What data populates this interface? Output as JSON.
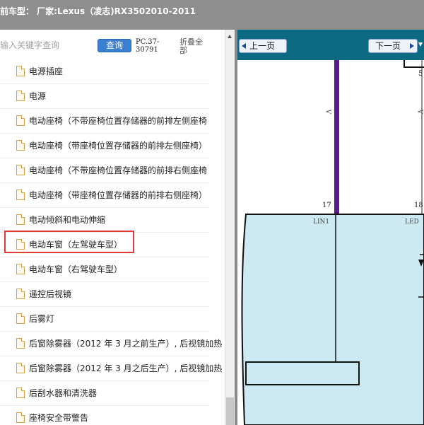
{
  "window": {
    "title": "前车型： 厂家:Lexus（凌志)RX3502010-2011"
  },
  "search": {
    "placeholder": "输入关键字查询",
    "query_label": "查询",
    "pc_code": "PC.37-30791",
    "collapse_label": "折叠全部"
  },
  "tree": {
    "items": [
      {
        "label": "电源插座"
      },
      {
        "label": "电源"
      },
      {
        "label": "电动座椅（不带座椅位置存储器的前排左侧座椅"
      },
      {
        "label": "电动座椅（带座椅位置存储器的前排左侧座椅）"
      },
      {
        "label": "电动座椅（不带座椅位置存储器的前排右侧座椅"
      },
      {
        "label": "电动座椅（带座椅位置存储器的前排右侧座椅）"
      },
      {
        "label": "电动倾斜和电动伸缩"
      },
      {
        "label": "电动车窗（左驾驶车型）",
        "highlighted": true
      },
      {
        "label": "电动车窗（右驾驶车型）"
      },
      {
        "label": "遥控后视镜"
      },
      {
        "label": "后雾灯"
      },
      {
        "label": "后窗除雾器（2012 年 3 月之前生产）, 后视镜加热"
      },
      {
        "label": "后窗除雾器（2012 年 3 月之后生产）, 后视镜加热"
      },
      {
        "label": "后刮水器和清洗器"
      },
      {
        "label": "座椅安全带警告"
      }
    ]
  },
  "viewer": {
    "prev_label": "上一页",
    "next_label": "下一页",
    "pin_left": "17",
    "pin_right": "18",
    "pin_top": "5",
    "wire_label_left": "V",
    "wire_label_right": "V",
    "connector_left": "LIN1",
    "connector_right": "LED"
  },
  "colors": {
    "title_bar": "#8e8e8e",
    "nav_bar": "#0c6a82",
    "wire_purple": "#5b1a8c",
    "ecu_fill": "#cdeaf2",
    "highlight": "#e23a3a",
    "query_button": "#3a7fd0"
  },
  "icons": {
    "tree_item": "document-icon",
    "prev": "triangle-left-icon",
    "next": "triangle-right-icon"
  }
}
